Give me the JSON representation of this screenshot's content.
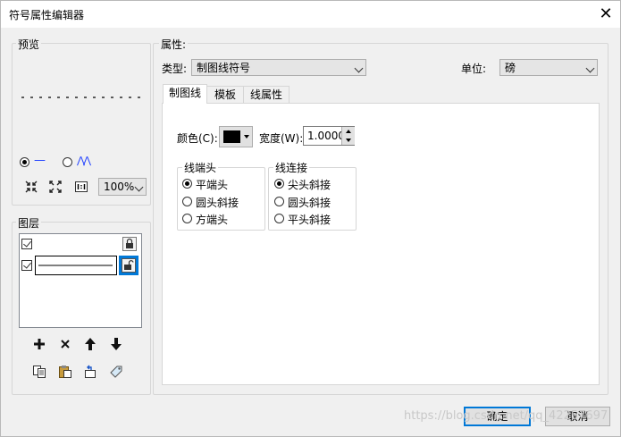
{
  "window": {
    "title": "符号属性编辑器",
    "close_glyph": "✕"
  },
  "preview": {
    "group_label": "预览",
    "radio_line_label": "—",
    "radio_wave_label": "⋀⋀",
    "zoom_value": "100%"
  },
  "layers": {
    "group_label": "图层"
  },
  "properties": {
    "group_label": "属性:",
    "type_label": "类型:",
    "type_value": "制图线符号",
    "unit_label": "单位:",
    "unit_value": "磅"
  },
  "tabs": [
    "制图线",
    "模板",
    "线属性"
  ],
  "linetab": {
    "color_label": "颜色(C):",
    "color_value": "#000000",
    "width_label": "宽度(W):",
    "width_value": "1.0000",
    "cap": {
      "group_label": "线端头",
      "options": [
        "平端头",
        "圆头斜接",
        "方端头"
      ],
      "selected": 0
    },
    "join": {
      "group_label": "线连接",
      "options": [
        "尖头斜接",
        "圆头斜接",
        "平头斜接"
      ],
      "selected": 0
    }
  },
  "buttons": {
    "ok": "确定",
    "cancel": "取消"
  },
  "watermark": "https://blog.csdn.net/qq_42257697"
}
